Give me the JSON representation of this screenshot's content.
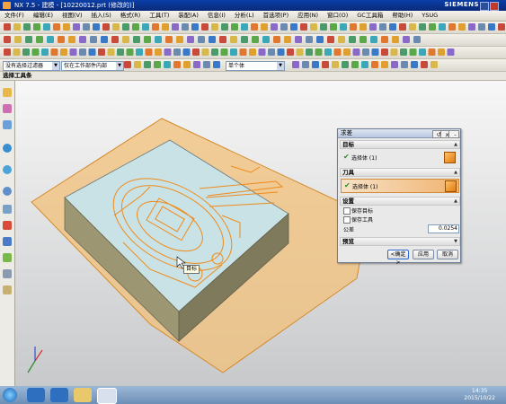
{
  "window": {
    "title": "NX 7.5 - 建模 - [10220012.prt (修改的)]",
    "brand": "SIEMENS"
  },
  "menu": [
    "文件(F)",
    "编辑(E)",
    "视图(V)",
    "插入(S)",
    "格式(R)",
    "工具(T)",
    "装配(A)",
    "信息(I)",
    "分析(L)",
    "首选项(P)",
    "应用(N)",
    "窗口(O)",
    "GC工具箱",
    "帮助(H)",
    "YSUG"
  ],
  "filters": {
    "select_filter": "没有选择过滤器",
    "scope": "仅在工作部件内部",
    "body_type": "单个体"
  },
  "selection_toolbar_title": "选择工具条",
  "dialog": {
    "title": "求差",
    "target_group": "目标",
    "target_select": "选择体 (1)",
    "tool_group": "刀具",
    "tool_select": "选择体 (1)",
    "settings_group": "设置",
    "keep_target": "保存目标",
    "keep_tool": "保存工具",
    "tolerance_label": "公差",
    "tolerance_value": "0.0254",
    "preview_group": "预览",
    "ok": "<确定>",
    "apply": "应用",
    "cancel": "取消"
  },
  "viewport": {
    "tooltip": "目标"
  },
  "taskbar": {
    "time": "14:35",
    "date": "2015/10/22"
  },
  "colors": {
    "titlebar": "#0b3fa8",
    "part_top": "#c9e2e6",
    "part_side": "#8f8a6a",
    "sheet": "#f2c07a",
    "highlight": "#f08a1a"
  }
}
